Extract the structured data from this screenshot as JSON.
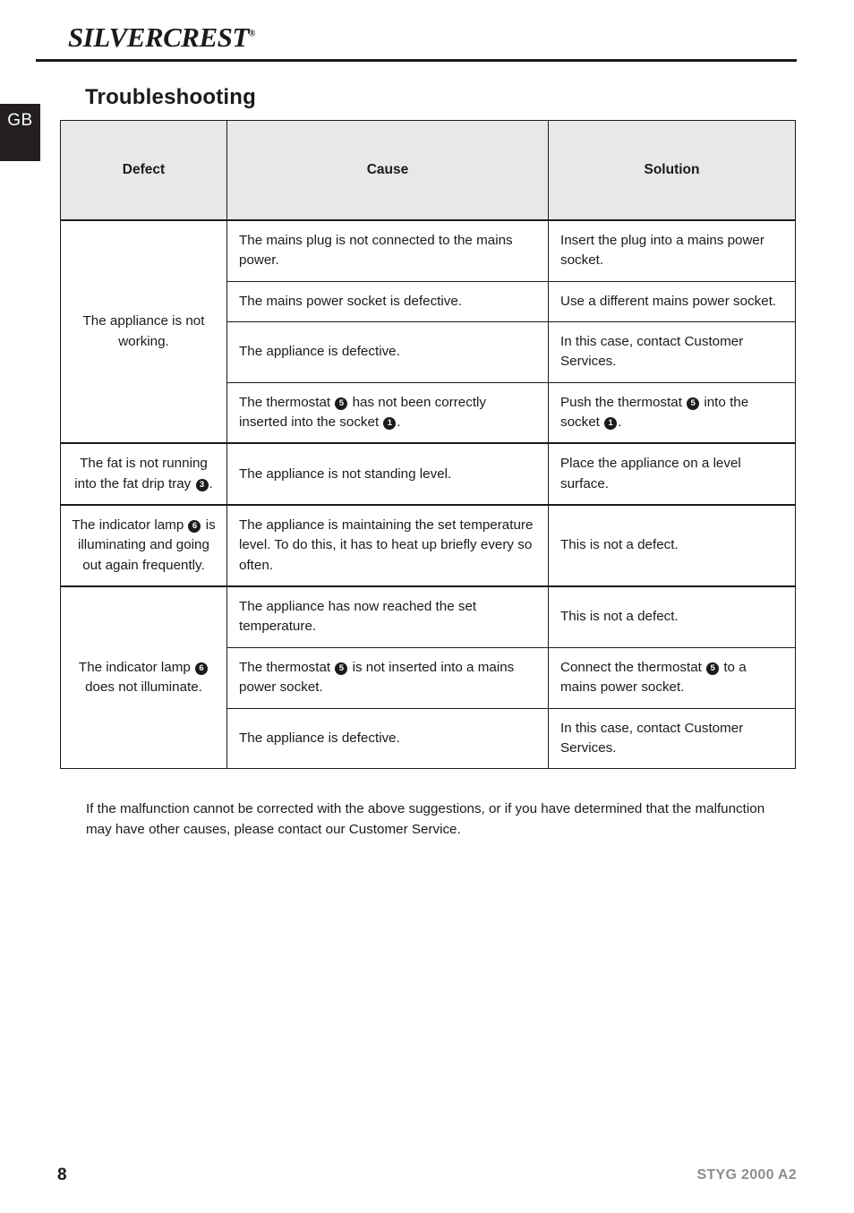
{
  "header": {
    "brand_part1": "SILVER",
    "brand_part2": "CREST",
    "registered_mark": "®"
  },
  "language_tab": {
    "label": "GB"
  },
  "page_title": "Troubleshooting",
  "table": {
    "columns": [
      "Defect",
      "Cause",
      "Solution"
    ],
    "groups": [
      {
        "defect_prefix": "The appliance is not working.",
        "defect_marker": null,
        "defect_suffix": "",
        "rows": [
          {
            "cause": "The mains plug is not connected to the mains power.",
            "solution": "Insert the plug into a mains power socket."
          },
          {
            "cause": "The mains power socket is defective.",
            "solution": "Use a different mains power socket."
          },
          {
            "cause": "The appliance is defective.",
            "solution": "In this case, contact Customer Services."
          },
          {
            "cause_part1": "The thermostat ",
            "cause_marker1": "5",
            "cause_part2": " has not been correctly inserted into the socket ",
            "cause_marker2": "1",
            "cause_part3": ".",
            "solution_part1": "Push the thermostat ",
            "solution_marker1": "5",
            "solution_part2": " into the socket ",
            "solution_marker2": "1",
            "solution_part3": "."
          }
        ]
      },
      {
        "defect_prefix": "The fat is not running into the fat drip tray ",
        "defect_marker": "3",
        "defect_suffix": ".",
        "rows": [
          {
            "cause": "The appliance is not standing level.",
            "solution": "Place the appliance on a level surface."
          }
        ]
      },
      {
        "defect_prefix": "The indicator lamp ",
        "defect_marker": "6",
        "defect_suffix": " is illuminating and going out again frequently.",
        "rows": [
          {
            "cause": "The appliance is maintaining the set temperature level. To do this, it has to heat up briefly every so often.",
            "solution": "This is not a defect."
          }
        ]
      },
      {
        "defect_prefix": "The indicator lamp ",
        "defect_marker": "6",
        "defect_suffix": " does not illuminate.",
        "rows": [
          {
            "cause": "The appliance has now reached the set temperature.",
            "solution": "This is not a defect."
          },
          {
            "cause_part1": "The thermostat ",
            "cause_marker1": "5",
            "cause_part2": " is not inserted into a mains power socket.",
            "solution_part1": "Connect the thermostat ",
            "solution_marker1": "5",
            "solution_part2": " to a mains power socket."
          },
          {
            "cause": "The appliance is defective.",
            "solution": "In this case, contact Customer Services."
          }
        ]
      }
    ]
  },
  "note": "If the malfunction cannot be corrected with the above suggestions, or if you have determined that the malfunction may have other causes, please contact our Customer Service.",
  "footer": {
    "page_number": "8",
    "model": "STYG 2000 A2"
  }
}
